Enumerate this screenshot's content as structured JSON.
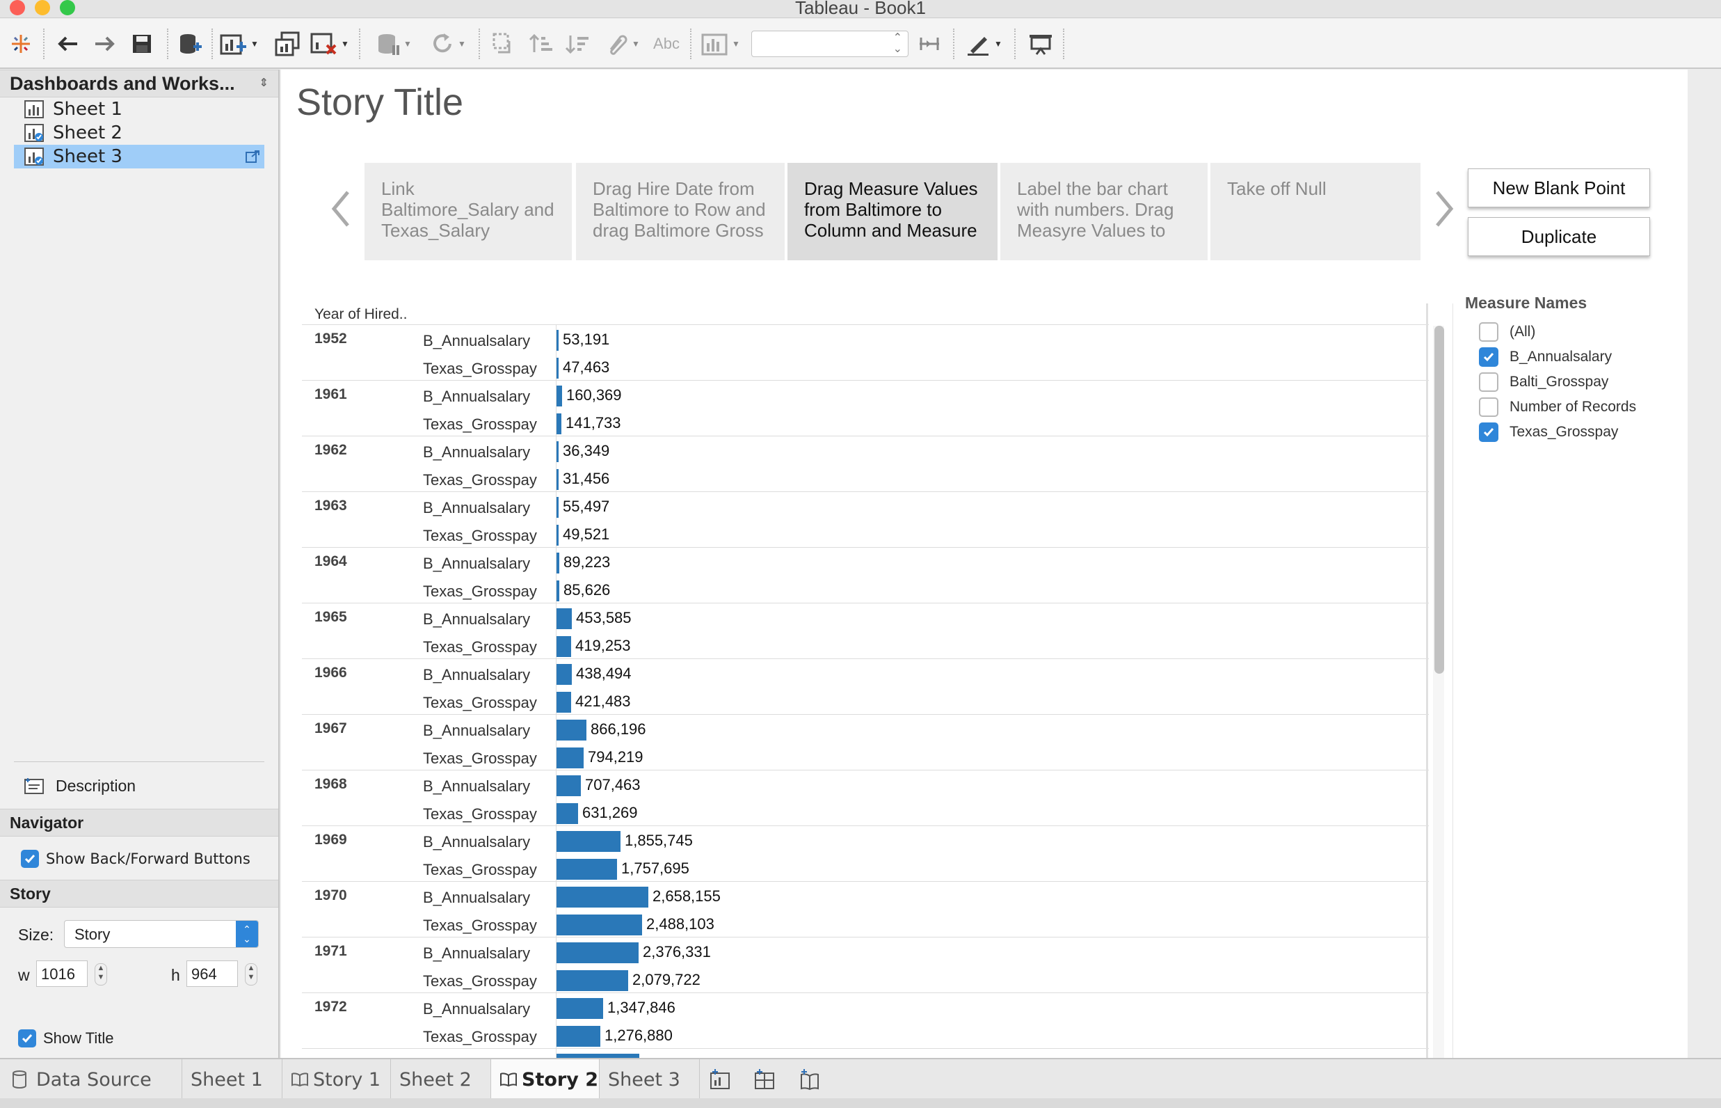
{
  "window": {
    "title": "Tableau - Book1"
  },
  "colors": {
    "accent": "#2f86d9",
    "bar": "#2a78b8",
    "selection": "#9fcdf8"
  },
  "toolbar": {
    "icons": [
      "tableau-logo-icon",
      "undo-icon",
      "redo-icon",
      "save-icon",
      "new-data-source-icon",
      "new-worksheet-icon",
      "duplicate-sheet-icon",
      "clear-sheet-icon",
      "pause-updates-icon",
      "refresh-icon",
      "swap-icon",
      "sort-ascending-icon",
      "sort-descending-icon",
      "group-icon",
      "labels-icon",
      "show-me-icon",
      "fit-select",
      "fix-axes-icon",
      "highlight-icon",
      "presentation-icon"
    ],
    "labels_button": "Abc"
  },
  "left_panel": {
    "header": "Dashboards and Works...",
    "sheets": [
      {
        "label": "Sheet 1",
        "selected": false
      },
      {
        "label": "Sheet 2",
        "selected": false
      },
      {
        "label": "Sheet 3",
        "selected": true
      }
    ],
    "description": "Description",
    "navigator_header": "Navigator",
    "show_back_forward": "Show Back/Forward Buttons",
    "story_header": "Story",
    "size_label": "Size:",
    "size_value": "Story",
    "w_label": "w",
    "w_value": "1016",
    "h_label": "h",
    "h_value": "964",
    "show_title": "Show Title"
  },
  "story": {
    "title": "Story Title",
    "points": [
      {
        "text": "Link Baltimore_Salary and Texas_Salary",
        "active": false
      },
      {
        "text": "Drag Hire Date from Baltimore to Row and drag Baltimore Gross",
        "active": false
      },
      {
        "text": "Drag Measure Values from Baltimore to Column and Measure",
        "active": true
      },
      {
        "text": "Label the bar chart with numbers. Drag Measyre Values to",
        "active": false
      },
      {
        "text": "Take off Null",
        "active": false
      }
    ],
    "new_blank_point": "New Blank Point",
    "duplicate": "Duplicate"
  },
  "chart_data": {
    "type": "bar",
    "row_header": "Year of Hired..",
    "measures": [
      "B_Annualsalary",
      "Texas_Grosspay"
    ],
    "rows": [
      {
        "year": "1952",
        "values": [
          53191,
          47463
        ],
        "labels": [
          "53,191",
          "47,463"
        ]
      },
      {
        "year": "1961",
        "values": [
          160369,
          141733
        ],
        "labels": [
          "160,369",
          "141,733"
        ]
      },
      {
        "year": "1962",
        "values": [
          36349,
          31456
        ],
        "labels": [
          "36,349",
          "31,456"
        ]
      },
      {
        "year": "1963",
        "values": [
          55497,
          49521
        ],
        "labels": [
          "55,497",
          "49,521"
        ]
      },
      {
        "year": "1964",
        "values": [
          89223,
          85626
        ],
        "labels": [
          "89,223",
          "85,626"
        ]
      },
      {
        "year": "1965",
        "values": [
          453585,
          419253
        ],
        "labels": [
          "453,585",
          "419,253"
        ]
      },
      {
        "year": "1966",
        "values": [
          438494,
          421483
        ],
        "labels": [
          "438,494",
          "421,483"
        ]
      },
      {
        "year": "1967",
        "values": [
          866196,
          794219
        ],
        "labels": [
          "866,196",
          "794,219"
        ]
      },
      {
        "year": "1968",
        "values": [
          707463,
          631269
        ],
        "labels": [
          "707,463",
          "631,269"
        ]
      },
      {
        "year": "1969",
        "values": [
          1855745,
          1757695
        ],
        "labels": [
          "1,855,745",
          "1,757,695"
        ]
      },
      {
        "year": "1970",
        "values": [
          2658155,
          2488103
        ],
        "labels": [
          "2,658,155",
          "2,488,103"
        ]
      },
      {
        "year": "1971",
        "values": [
          2376331,
          2079722
        ],
        "labels": [
          "2,376,331",
          "2,079,722"
        ]
      },
      {
        "year": "1972",
        "values": [
          1347846,
          1276880
        ],
        "labels": [
          "1,347,846",
          "1,276,880"
        ]
      },
      {
        "year": "",
        "values": [
          2400000
        ],
        "labels": [
          ""
        ]
      }
    ],
    "xlim": [
      0,
      25000000
    ],
    "grid": false
  },
  "legend": {
    "title": "Measure Names",
    "items": [
      {
        "label": "(All)",
        "checked": false
      },
      {
        "label": "B_Annualsalary",
        "checked": true
      },
      {
        "label": "Balti_Grosspay",
        "checked": false
      },
      {
        "label": "Number of Records",
        "checked": false
      },
      {
        "label": "Texas_Grosspay",
        "checked": true
      }
    ]
  },
  "tabs": [
    {
      "label": "Data Source",
      "icon": "data-source-icon",
      "active": false
    },
    {
      "label": "Sheet 1",
      "active": false
    },
    {
      "label": "Story 1",
      "icon": "story-icon",
      "active": false
    },
    {
      "label": "Sheet 2",
      "active": false
    },
    {
      "label": "Story 2",
      "icon": "story-icon",
      "active": true
    },
    {
      "label": "Sheet 3",
      "active": false
    }
  ]
}
